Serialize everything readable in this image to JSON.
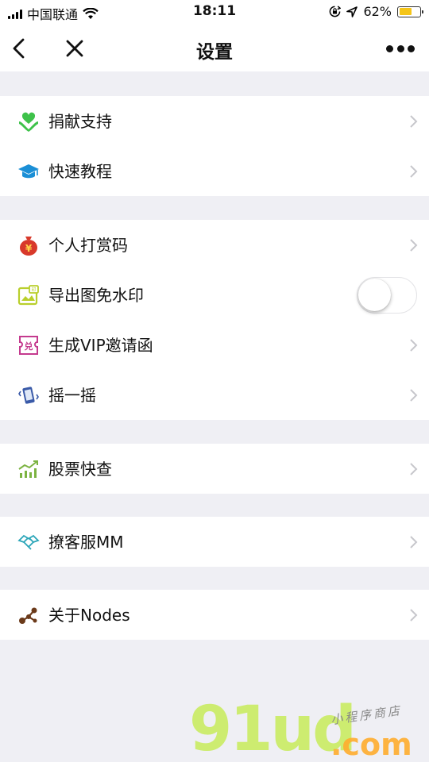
{
  "status_bar": {
    "carrier": "中国联通",
    "time": "18:11",
    "battery_percent": "62%",
    "battery_level": 0.62,
    "battery_color": "#f5c518",
    "icons": [
      "signal-icon",
      "wifi-icon",
      "rotation-lock-icon",
      "location-icon",
      "battery-icon"
    ]
  },
  "nav": {
    "title": "设置",
    "back_icon": "chevron-left-icon",
    "close_icon": "close-icon",
    "more_icon": "more-dots-icon"
  },
  "groups": [
    {
      "items": [
        {
          "label": "捐献支持",
          "icon": "heart-hands-icon",
          "control": "chevron"
        },
        {
          "label": "快速教程",
          "icon": "graduation-cap-icon",
          "control": "chevron"
        }
      ]
    },
    {
      "items": [
        {
          "label": "个人打赏码",
          "icon": "money-bag-icon",
          "control": "chevron"
        },
        {
          "label": "导出图免水印",
          "icon": "image-stamp-icon",
          "control": "toggle",
          "toggle_on": false
        },
        {
          "label": "生成VIP邀请函",
          "icon": "voucher-icon",
          "control": "chevron"
        },
        {
          "label": "摇一摇",
          "icon": "shake-phone-icon",
          "control": "chevron"
        }
      ]
    },
    {
      "items": [
        {
          "label": "股票快查",
          "icon": "stock-chart-icon",
          "control": "chevron"
        }
      ]
    },
    {
      "items": [
        {
          "label": "撩客服MM",
          "icon": "handshake-icon",
          "control": "chevron"
        }
      ]
    },
    {
      "items": [
        {
          "label": "关于Nodes",
          "icon": "nodes-icon",
          "control": "chevron"
        }
      ]
    }
  ],
  "watermark": {
    "main": "91ud",
    "domain": ".com",
    "tagline": "小程序商店"
  }
}
